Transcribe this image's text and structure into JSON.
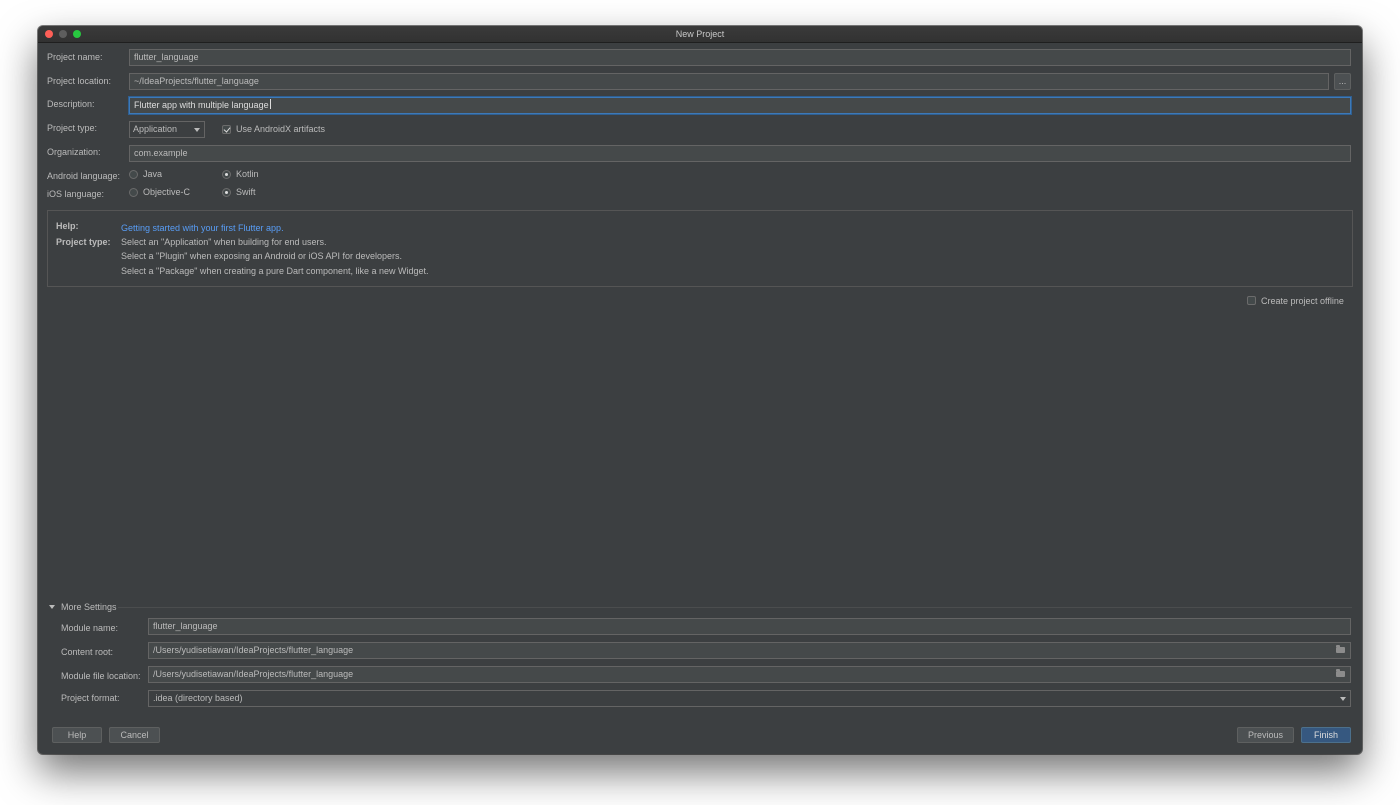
{
  "window": {
    "title": "New Project"
  },
  "form": {
    "project_name_label": "Project name:",
    "project_name_value": "flutter_language",
    "project_location_label": "Project location:",
    "project_location_value": "~/IdeaProjects/flutter_language",
    "browse_label": "...",
    "description_label": "Description:",
    "description_value": "Flutter app with multiple language",
    "project_type_label": "Project type:",
    "project_type_value": "Application",
    "androidx_label": "Use AndroidX artifacts",
    "androidx_checked": true,
    "organization_label": "Organization:",
    "organization_value": "com.example",
    "android_language_label": "Android language:",
    "android_options": [
      "Java",
      "Kotlin"
    ],
    "android_selected": "Kotlin",
    "ios_language_label": "iOS language:",
    "ios_options": [
      "Objective-C",
      "Swift"
    ],
    "ios_selected": "Swift"
  },
  "help": {
    "help_label": "Help:",
    "help_link": "Getting started with your first Flutter app.",
    "type_label": "Project type:",
    "lines": [
      "Select an \"Application\" when building for end users.",
      "Select a \"Plugin\" when exposing an Android or iOS API for developers.",
      "Select a \"Package\" when creating a pure Dart component, like a new Widget."
    ]
  },
  "offline": {
    "label": "Create project offline",
    "checked": false
  },
  "more_settings": {
    "title": "More Settings",
    "module_name_label": "Module name:",
    "module_name_value": "flutter_language",
    "content_root_label": "Content root:",
    "content_root_value": "/Users/yudisetiawan/IdeaProjects/flutter_language",
    "module_file_label": "Module file location:",
    "module_file_value": "/Users/yudisetiawan/IdeaProjects/flutter_language",
    "project_format_label": "Project format:",
    "project_format_value": ".idea (directory based)"
  },
  "buttons": {
    "help": "Help",
    "cancel": "Cancel",
    "previous": "Previous",
    "finish": "Finish"
  },
  "colors": {
    "background": "#3c3f41",
    "field": "#45494a",
    "link": "#589df6",
    "focus": "#3d79b8",
    "primary_button": "#365880"
  }
}
